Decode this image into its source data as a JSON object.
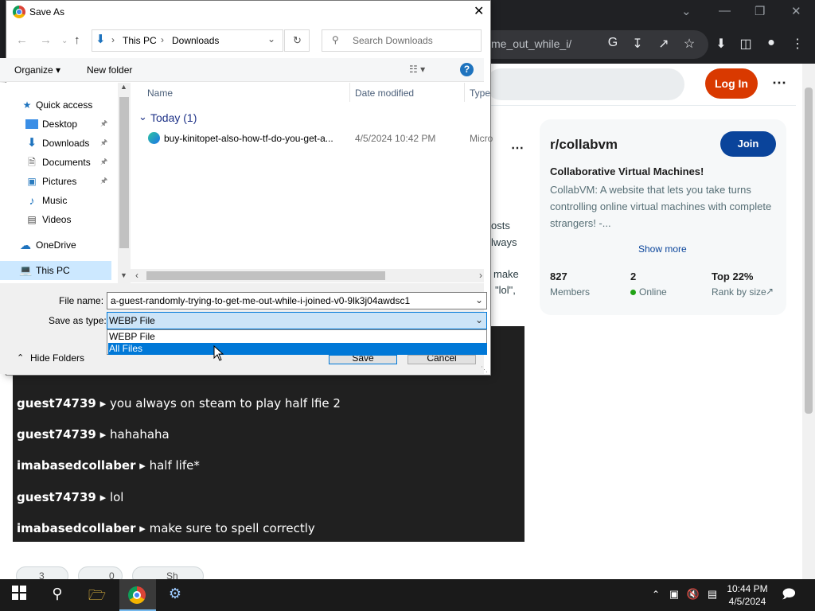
{
  "browser": {
    "url_fragment": "me_out_while_i/"
  },
  "reddit": {
    "login": "Log In",
    "post_snippets": [
      "osts",
      "lways",
      "make",
      "\"lol\","
    ],
    "sidebar": {
      "name": "r/collabvm",
      "join": "Join",
      "subtitle": "Collaborative Virtual Machines!",
      "description": "CollabVM: A website that lets you take turns controlling online virtual machines with complete strangers! -...",
      "show_more": "Show more",
      "stats": [
        {
          "value": "827",
          "label": "Members"
        },
        {
          "value": "2",
          "label": "Online"
        },
        {
          "value": "Top 22%",
          "label": "Rank by size"
        }
      ]
    },
    "chat": [
      {
        "user": "guest74739",
        "msg": "you always on steam to play half lfie 2"
      },
      {
        "user": "guest74739",
        "msg": "hahahaha"
      },
      {
        "user": "imabasedcollaber",
        "msg": "half life*"
      },
      {
        "user": "guest74739",
        "msg": "lol"
      },
      {
        "user": "imabasedcollaber",
        "msg": "make sure to spell correctly"
      }
    ],
    "pill_labels": [
      "3",
      "0",
      "Sh"
    ]
  },
  "dialog": {
    "title": "Save As",
    "path": [
      "This PC",
      "Downloads"
    ],
    "search_placeholder": "Search Downloads",
    "organize": "Organize",
    "new_folder": "New folder",
    "nav_items": [
      {
        "label": "Quick access"
      },
      {
        "label": "Desktop"
      },
      {
        "label": "Downloads"
      },
      {
        "label": "Documents"
      },
      {
        "label": "Pictures"
      },
      {
        "label": "Music"
      },
      {
        "label": "Videos"
      },
      {
        "label": "OneDrive"
      },
      {
        "label": "This PC"
      }
    ],
    "columns": {
      "name": "Name",
      "date": "Date modified",
      "type": "Type"
    },
    "group": "Today (1)",
    "file": {
      "name": "buy-kinitopet-also-how-tf-do-you-get-a...",
      "date": "4/5/2024 10:42 PM",
      "type": "Micro"
    },
    "file_name_label": "File name:",
    "file_name_value": "a-guest-randomly-trying-to-get-me-out-while-i-joined-v0-9lk3j04awdsc1",
    "save_type_label": "Save as type:",
    "save_type_value": "WEBP File",
    "dropdown_options": [
      "WEBP File",
      "All Files"
    ],
    "hide_folders": "Hide Folders",
    "save": "Save",
    "cancel": "Cancel"
  },
  "taskbar": {
    "time": "10:44 PM",
    "date": "4/5/2024"
  }
}
